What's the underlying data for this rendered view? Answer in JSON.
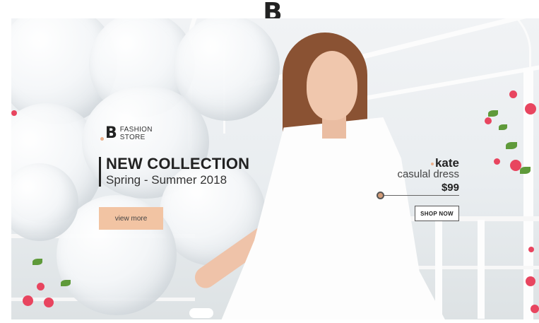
{
  "logo": {
    "letter": "B"
  },
  "brand": {
    "letter": "B",
    "name_line1": "FASHION",
    "name_line2": "STORE"
  },
  "hero": {
    "headline": "NEW COLLECTION",
    "subheadline": "Spring - Summer 2018",
    "cta_label": "view more"
  },
  "product": {
    "name": "kate",
    "description": "casulal dress",
    "price": "$99",
    "cta_label": "SHOP NOW"
  },
  "colors": {
    "accent": "#f2c4a3",
    "dot": "#eab08c",
    "text_dark": "#222222"
  }
}
